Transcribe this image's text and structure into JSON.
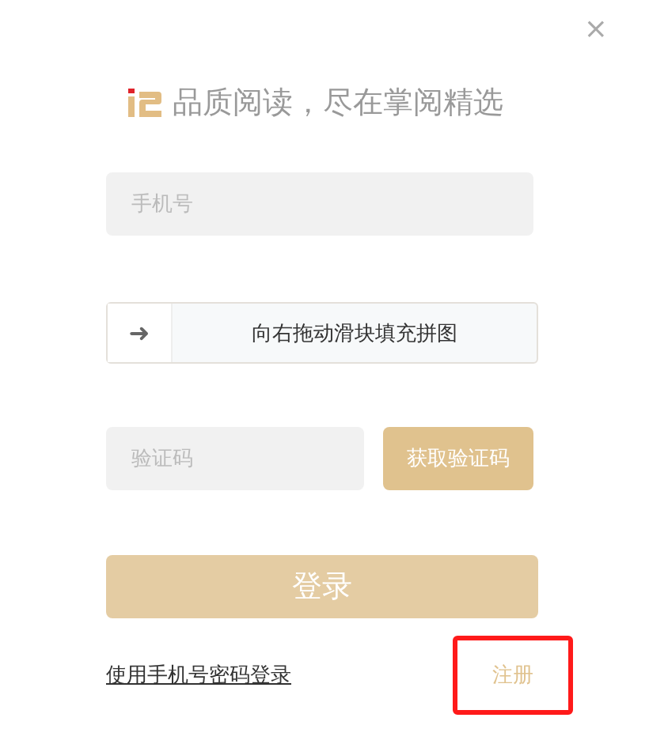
{
  "close": "×",
  "title": "品质阅读，尽在掌阅精选",
  "phone": {
    "placeholder": "手机号"
  },
  "slider": {
    "arrow": "➜",
    "label": "向右拖动滑块填充拼图"
  },
  "code": {
    "placeholder": "验证码",
    "button": "获取验证码"
  },
  "login": {
    "label": "登录",
    "disabled": true
  },
  "links": {
    "password_login": "使用手机号密码登录",
    "register": "注册",
    "register_highlighted": true
  }
}
